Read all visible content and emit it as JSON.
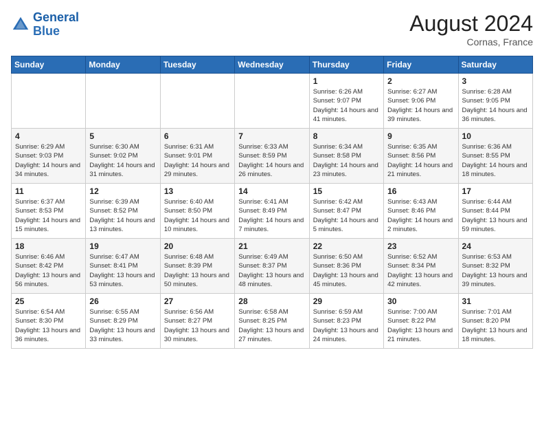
{
  "logo": {
    "text_general": "General",
    "text_blue": "Blue"
  },
  "title": "August 2024",
  "location": "Cornas, France",
  "days_of_week": [
    "Sunday",
    "Monday",
    "Tuesday",
    "Wednesday",
    "Thursday",
    "Friday",
    "Saturday"
  ],
  "weeks": [
    [
      {
        "num": "",
        "info": ""
      },
      {
        "num": "",
        "info": ""
      },
      {
        "num": "",
        "info": ""
      },
      {
        "num": "",
        "info": ""
      },
      {
        "num": "1",
        "info": "Sunrise: 6:26 AM\nSunset: 9:07 PM\nDaylight: 14 hours and 41 minutes."
      },
      {
        "num": "2",
        "info": "Sunrise: 6:27 AM\nSunset: 9:06 PM\nDaylight: 14 hours and 39 minutes."
      },
      {
        "num": "3",
        "info": "Sunrise: 6:28 AM\nSunset: 9:05 PM\nDaylight: 14 hours and 36 minutes."
      }
    ],
    [
      {
        "num": "4",
        "info": "Sunrise: 6:29 AM\nSunset: 9:03 PM\nDaylight: 14 hours and 34 minutes."
      },
      {
        "num": "5",
        "info": "Sunrise: 6:30 AM\nSunset: 9:02 PM\nDaylight: 14 hours and 31 minutes."
      },
      {
        "num": "6",
        "info": "Sunrise: 6:31 AM\nSunset: 9:01 PM\nDaylight: 14 hours and 29 minutes."
      },
      {
        "num": "7",
        "info": "Sunrise: 6:33 AM\nSunset: 8:59 PM\nDaylight: 14 hours and 26 minutes."
      },
      {
        "num": "8",
        "info": "Sunrise: 6:34 AM\nSunset: 8:58 PM\nDaylight: 14 hours and 23 minutes."
      },
      {
        "num": "9",
        "info": "Sunrise: 6:35 AM\nSunset: 8:56 PM\nDaylight: 14 hours and 21 minutes."
      },
      {
        "num": "10",
        "info": "Sunrise: 6:36 AM\nSunset: 8:55 PM\nDaylight: 14 hours and 18 minutes."
      }
    ],
    [
      {
        "num": "11",
        "info": "Sunrise: 6:37 AM\nSunset: 8:53 PM\nDaylight: 14 hours and 15 minutes."
      },
      {
        "num": "12",
        "info": "Sunrise: 6:39 AM\nSunset: 8:52 PM\nDaylight: 14 hours and 13 minutes."
      },
      {
        "num": "13",
        "info": "Sunrise: 6:40 AM\nSunset: 8:50 PM\nDaylight: 14 hours and 10 minutes."
      },
      {
        "num": "14",
        "info": "Sunrise: 6:41 AM\nSunset: 8:49 PM\nDaylight: 14 hours and 7 minutes."
      },
      {
        "num": "15",
        "info": "Sunrise: 6:42 AM\nSunset: 8:47 PM\nDaylight: 14 hours and 5 minutes."
      },
      {
        "num": "16",
        "info": "Sunrise: 6:43 AM\nSunset: 8:46 PM\nDaylight: 14 hours and 2 minutes."
      },
      {
        "num": "17",
        "info": "Sunrise: 6:44 AM\nSunset: 8:44 PM\nDaylight: 13 hours and 59 minutes."
      }
    ],
    [
      {
        "num": "18",
        "info": "Sunrise: 6:46 AM\nSunset: 8:42 PM\nDaylight: 13 hours and 56 minutes."
      },
      {
        "num": "19",
        "info": "Sunrise: 6:47 AM\nSunset: 8:41 PM\nDaylight: 13 hours and 53 minutes."
      },
      {
        "num": "20",
        "info": "Sunrise: 6:48 AM\nSunset: 8:39 PM\nDaylight: 13 hours and 50 minutes."
      },
      {
        "num": "21",
        "info": "Sunrise: 6:49 AM\nSunset: 8:37 PM\nDaylight: 13 hours and 48 minutes."
      },
      {
        "num": "22",
        "info": "Sunrise: 6:50 AM\nSunset: 8:36 PM\nDaylight: 13 hours and 45 minutes."
      },
      {
        "num": "23",
        "info": "Sunrise: 6:52 AM\nSunset: 8:34 PM\nDaylight: 13 hours and 42 minutes."
      },
      {
        "num": "24",
        "info": "Sunrise: 6:53 AM\nSunset: 8:32 PM\nDaylight: 13 hours and 39 minutes."
      }
    ],
    [
      {
        "num": "25",
        "info": "Sunrise: 6:54 AM\nSunset: 8:30 PM\nDaylight: 13 hours and 36 minutes."
      },
      {
        "num": "26",
        "info": "Sunrise: 6:55 AM\nSunset: 8:29 PM\nDaylight: 13 hours and 33 minutes."
      },
      {
        "num": "27",
        "info": "Sunrise: 6:56 AM\nSunset: 8:27 PM\nDaylight: 13 hours and 30 minutes."
      },
      {
        "num": "28",
        "info": "Sunrise: 6:58 AM\nSunset: 8:25 PM\nDaylight: 13 hours and 27 minutes."
      },
      {
        "num": "29",
        "info": "Sunrise: 6:59 AM\nSunset: 8:23 PM\nDaylight: 13 hours and 24 minutes."
      },
      {
        "num": "30",
        "info": "Sunrise: 7:00 AM\nSunset: 8:22 PM\nDaylight: 13 hours and 21 minutes."
      },
      {
        "num": "31",
        "info": "Sunrise: 7:01 AM\nSunset: 8:20 PM\nDaylight: 13 hours and 18 minutes."
      }
    ]
  ]
}
